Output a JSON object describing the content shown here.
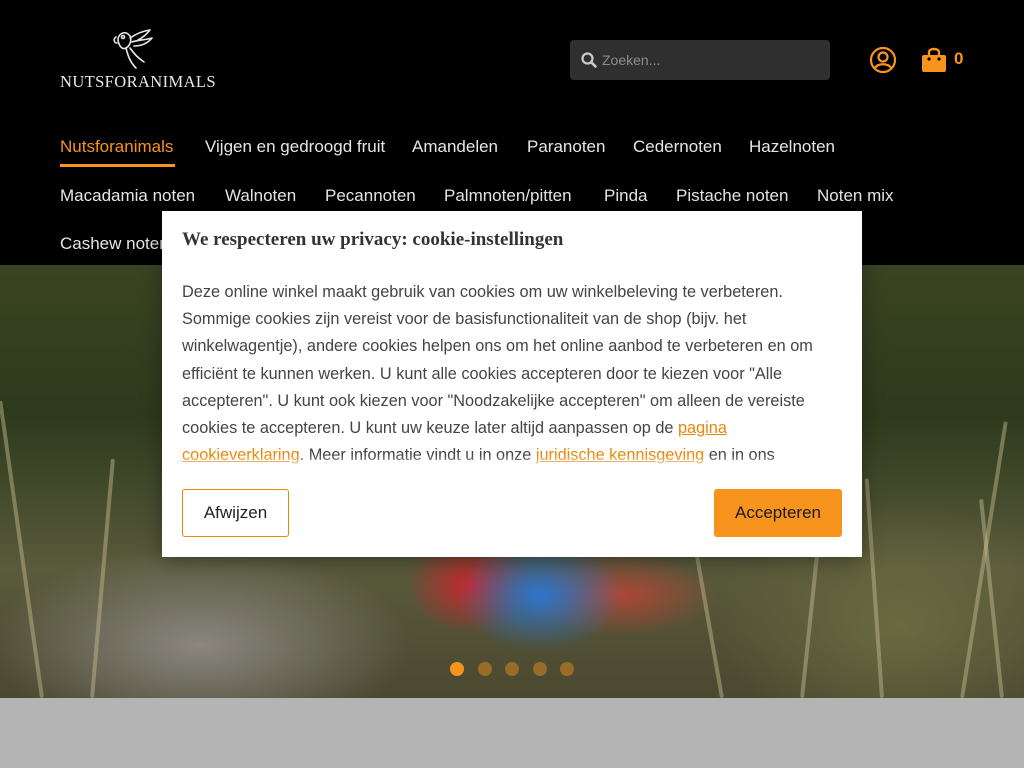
{
  "brand": {
    "logo_text": "NUTSFORANIMALS",
    "accent_color": "#f7941d"
  },
  "search": {
    "placeholder": "Zoeken...",
    "icon": "search-icon"
  },
  "account": {
    "icon": "user-circle-icon"
  },
  "cart": {
    "icon": "shopping-bag-icon",
    "count": "0"
  },
  "nav": {
    "items": [
      {
        "label": "Nutsforanimals",
        "active": true
      },
      {
        "label": "Vijgen en gedroogd fruit"
      },
      {
        "label": "Amandelen"
      },
      {
        "label": "Paranoten"
      },
      {
        "label": "Cedernoten"
      },
      {
        "label": "Hazelnoten"
      },
      {
        "label": "Macadamia noten"
      },
      {
        "label": "Walnoten"
      },
      {
        "label": "Pecannoten"
      },
      {
        "label": "Palmnoten/pitten"
      },
      {
        "label": "Pinda"
      },
      {
        "label": "Pistache noten"
      },
      {
        "label": "Noten mix"
      },
      {
        "label": "Cashew noten"
      }
    ]
  },
  "slider": {
    "slide_count": 5,
    "active_index": 0
  },
  "cookie_modal": {
    "title": "We respecteren uw privacy: cookie-instellingen",
    "body_part1": "Deze online winkel maakt gebruik van cookies om uw winkelbeleving te verbeteren. Sommige cookies zijn vereist voor de basisfunctionaliteit van de shop (bijv. het winkelwagentje), andere cookies helpen ons om het online aanbod te verbeteren en om efficiënt te kunnen werken. U kunt alle cookies accepteren door te kiezen voor \"Alle accepteren\". U kunt ook kiezen voor \"Noodzakelijke accepteren\" om alleen de vereiste cookies te accepteren. U kunt uw keuze later altijd aanpassen op de ",
    "link1": "pagina cookieverklaring",
    "body_part2": ". Meer informatie vindt u in onze ",
    "link2": "juridische kennisgeving",
    "body_part3": " en in ons",
    "decline_label": "Afwijzen",
    "accept_label": "Accepteren"
  }
}
